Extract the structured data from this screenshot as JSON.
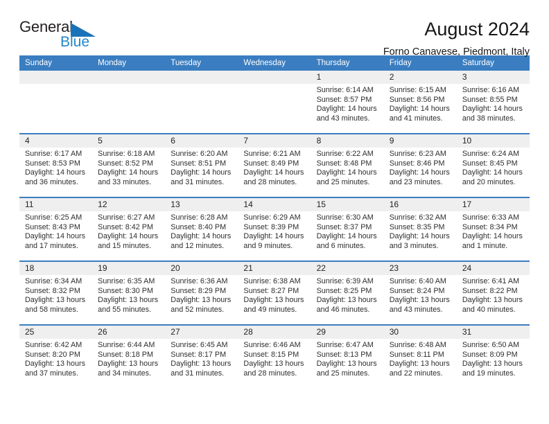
{
  "brand": {
    "name_top": "General",
    "name_bottom": "Blue",
    "triangle_color": "#1a72b8",
    "text_color": "#231f20",
    "blue_color": "#2386c8"
  },
  "header": {
    "title": "August 2024",
    "subtitle": "Forno Canavese, Piedmont, Italy"
  },
  "theme": {
    "header_blue": "#3a7dc0",
    "daynum_bg": "#efefef",
    "text": "#2d2d2d"
  },
  "labels": {
    "sunrise_prefix": "Sunrise:",
    "sunset_prefix": "Sunset:",
    "daylight_prefix": "Daylight:"
  },
  "weekdays": [
    "Sunday",
    "Monday",
    "Tuesday",
    "Wednesday",
    "Thursday",
    "Friday",
    "Saturday"
  ],
  "weeks": [
    [
      {
        "day": "",
        "empty": true
      },
      {
        "day": "",
        "empty": true
      },
      {
        "day": "",
        "empty": true
      },
      {
        "day": "",
        "empty": true
      },
      {
        "day": "1",
        "sunrise": "Sunrise: 6:14 AM",
        "sunset": "Sunset: 8:57 PM",
        "daylight_1": "Daylight: 14 hours",
        "daylight_2": "and 43 minutes."
      },
      {
        "day": "2",
        "sunrise": "Sunrise: 6:15 AM",
        "sunset": "Sunset: 8:56 PM",
        "daylight_1": "Daylight: 14 hours",
        "daylight_2": "and 41 minutes."
      },
      {
        "day": "3",
        "sunrise": "Sunrise: 6:16 AM",
        "sunset": "Sunset: 8:55 PM",
        "daylight_1": "Daylight: 14 hours",
        "daylight_2": "and 38 minutes."
      }
    ],
    [
      {
        "day": "4",
        "sunrise": "Sunrise: 6:17 AM",
        "sunset": "Sunset: 8:53 PM",
        "daylight_1": "Daylight: 14 hours",
        "daylight_2": "and 36 minutes."
      },
      {
        "day": "5",
        "sunrise": "Sunrise: 6:18 AM",
        "sunset": "Sunset: 8:52 PM",
        "daylight_1": "Daylight: 14 hours",
        "daylight_2": "and 33 minutes."
      },
      {
        "day": "6",
        "sunrise": "Sunrise: 6:20 AM",
        "sunset": "Sunset: 8:51 PM",
        "daylight_1": "Daylight: 14 hours",
        "daylight_2": "and 31 minutes."
      },
      {
        "day": "7",
        "sunrise": "Sunrise: 6:21 AM",
        "sunset": "Sunset: 8:49 PM",
        "daylight_1": "Daylight: 14 hours",
        "daylight_2": "and 28 minutes."
      },
      {
        "day": "8",
        "sunrise": "Sunrise: 6:22 AM",
        "sunset": "Sunset: 8:48 PM",
        "daylight_1": "Daylight: 14 hours",
        "daylight_2": "and 25 minutes."
      },
      {
        "day": "9",
        "sunrise": "Sunrise: 6:23 AM",
        "sunset": "Sunset: 8:46 PM",
        "daylight_1": "Daylight: 14 hours",
        "daylight_2": "and 23 minutes."
      },
      {
        "day": "10",
        "sunrise": "Sunrise: 6:24 AM",
        "sunset": "Sunset: 8:45 PM",
        "daylight_1": "Daylight: 14 hours",
        "daylight_2": "and 20 minutes."
      }
    ],
    [
      {
        "day": "11",
        "sunrise": "Sunrise: 6:25 AM",
        "sunset": "Sunset: 8:43 PM",
        "daylight_1": "Daylight: 14 hours",
        "daylight_2": "and 17 minutes."
      },
      {
        "day": "12",
        "sunrise": "Sunrise: 6:27 AM",
        "sunset": "Sunset: 8:42 PM",
        "daylight_1": "Daylight: 14 hours",
        "daylight_2": "and 15 minutes."
      },
      {
        "day": "13",
        "sunrise": "Sunrise: 6:28 AM",
        "sunset": "Sunset: 8:40 PM",
        "daylight_1": "Daylight: 14 hours",
        "daylight_2": "and 12 minutes."
      },
      {
        "day": "14",
        "sunrise": "Sunrise: 6:29 AM",
        "sunset": "Sunset: 8:39 PM",
        "daylight_1": "Daylight: 14 hours",
        "daylight_2": "and 9 minutes."
      },
      {
        "day": "15",
        "sunrise": "Sunrise: 6:30 AM",
        "sunset": "Sunset: 8:37 PM",
        "daylight_1": "Daylight: 14 hours",
        "daylight_2": "and 6 minutes."
      },
      {
        "day": "16",
        "sunrise": "Sunrise: 6:32 AM",
        "sunset": "Sunset: 8:35 PM",
        "daylight_1": "Daylight: 14 hours",
        "daylight_2": "and 3 minutes."
      },
      {
        "day": "17",
        "sunrise": "Sunrise: 6:33 AM",
        "sunset": "Sunset: 8:34 PM",
        "daylight_1": "Daylight: 14 hours",
        "daylight_2": "and 1 minute."
      }
    ],
    [
      {
        "day": "18",
        "sunrise": "Sunrise: 6:34 AM",
        "sunset": "Sunset: 8:32 PM",
        "daylight_1": "Daylight: 13 hours",
        "daylight_2": "and 58 minutes."
      },
      {
        "day": "19",
        "sunrise": "Sunrise: 6:35 AM",
        "sunset": "Sunset: 8:30 PM",
        "daylight_1": "Daylight: 13 hours",
        "daylight_2": "and 55 minutes."
      },
      {
        "day": "20",
        "sunrise": "Sunrise: 6:36 AM",
        "sunset": "Sunset: 8:29 PM",
        "daylight_1": "Daylight: 13 hours",
        "daylight_2": "and 52 minutes."
      },
      {
        "day": "21",
        "sunrise": "Sunrise: 6:38 AM",
        "sunset": "Sunset: 8:27 PM",
        "daylight_1": "Daylight: 13 hours",
        "daylight_2": "and 49 minutes."
      },
      {
        "day": "22",
        "sunrise": "Sunrise: 6:39 AM",
        "sunset": "Sunset: 8:25 PM",
        "daylight_1": "Daylight: 13 hours",
        "daylight_2": "and 46 minutes."
      },
      {
        "day": "23",
        "sunrise": "Sunrise: 6:40 AM",
        "sunset": "Sunset: 8:24 PM",
        "daylight_1": "Daylight: 13 hours",
        "daylight_2": "and 43 minutes."
      },
      {
        "day": "24",
        "sunrise": "Sunrise: 6:41 AM",
        "sunset": "Sunset: 8:22 PM",
        "daylight_1": "Daylight: 13 hours",
        "daylight_2": "and 40 minutes."
      }
    ],
    [
      {
        "day": "25",
        "sunrise": "Sunrise: 6:42 AM",
        "sunset": "Sunset: 8:20 PM",
        "daylight_1": "Daylight: 13 hours",
        "daylight_2": "and 37 minutes."
      },
      {
        "day": "26",
        "sunrise": "Sunrise: 6:44 AM",
        "sunset": "Sunset: 8:18 PM",
        "daylight_1": "Daylight: 13 hours",
        "daylight_2": "and 34 minutes."
      },
      {
        "day": "27",
        "sunrise": "Sunrise: 6:45 AM",
        "sunset": "Sunset: 8:17 PM",
        "daylight_1": "Daylight: 13 hours",
        "daylight_2": "and 31 minutes."
      },
      {
        "day": "28",
        "sunrise": "Sunrise: 6:46 AM",
        "sunset": "Sunset: 8:15 PM",
        "daylight_1": "Daylight: 13 hours",
        "daylight_2": "and 28 minutes."
      },
      {
        "day": "29",
        "sunrise": "Sunrise: 6:47 AM",
        "sunset": "Sunset: 8:13 PM",
        "daylight_1": "Daylight: 13 hours",
        "daylight_2": "and 25 minutes."
      },
      {
        "day": "30",
        "sunrise": "Sunrise: 6:48 AM",
        "sunset": "Sunset: 8:11 PM",
        "daylight_1": "Daylight: 13 hours",
        "daylight_2": "and 22 minutes."
      },
      {
        "day": "31",
        "sunrise": "Sunrise: 6:50 AM",
        "sunset": "Sunset: 8:09 PM",
        "daylight_1": "Daylight: 13 hours",
        "daylight_2": "and 19 minutes."
      }
    ]
  ]
}
